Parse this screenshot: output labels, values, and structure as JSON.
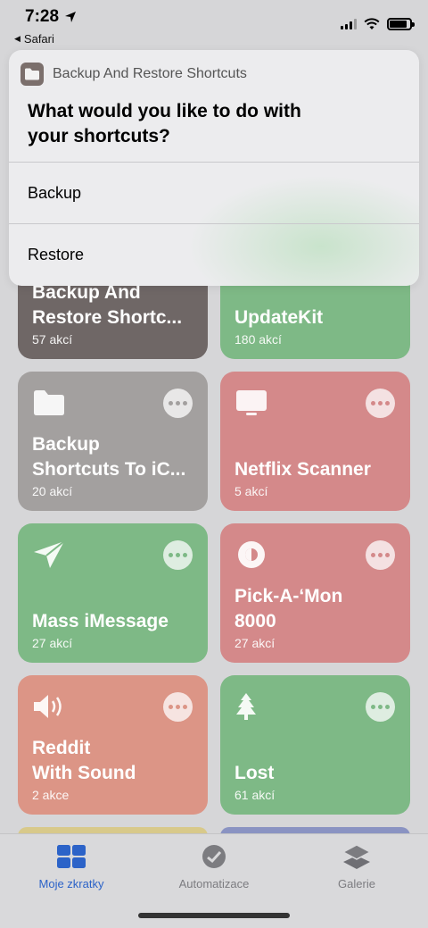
{
  "status_bar": {
    "time": "7:28",
    "back_app": "Safari"
  },
  "dialog": {
    "app_name": "Backup And Restore Shortcuts",
    "question": "What would you like to do with\nyour shortcuts?",
    "options": [
      {
        "label": "Backup"
      },
      {
        "label": "Restore"
      }
    ]
  },
  "shortcuts": [
    {
      "title": "Backup And\nRestore Shortc...",
      "subtitle": "57 akcí",
      "color": "#6f6766",
      "icon": "folder-icon"
    },
    {
      "title": "UpdateKit",
      "subtitle": "180 akcí",
      "color": "#7eb986",
      "icon": ""
    },
    {
      "title": "Backup\nShortcuts To iC...",
      "subtitle": "20 akcí",
      "color": "#a3a09f",
      "icon": "folder-icon"
    },
    {
      "title": "Netflix Scanner",
      "subtitle": "5 akcí",
      "color": "#d4898a",
      "icon": "tv-icon"
    },
    {
      "title": "Mass iMessage",
      "subtitle": "27 akcí",
      "color": "#7eb986",
      "icon": "paper-plane-icon"
    },
    {
      "title": "Pick-A-‘Mon\n8000",
      "subtitle": "27 akcí",
      "color": "#d4898a",
      "icon": "pokeball-icon"
    },
    {
      "title": "Reddit\nWith Sound",
      "subtitle": "2 akce",
      "color": "#dc9586",
      "icon": "speaker-icon"
    },
    {
      "title": "Lost",
      "subtitle": "61 akcí",
      "color": "#7eb986",
      "icon": "tree-icon"
    }
  ],
  "tabbar": {
    "tabs": [
      {
        "label": "Moje zkratky",
        "active": true,
        "icon": "grid-icon"
      },
      {
        "label": "Automatizace",
        "active": false,
        "icon": "clock-icon"
      },
      {
        "label": "Galerie",
        "active": false,
        "icon": "layers-icon"
      }
    ]
  },
  "colors": {
    "accent": "#2c63c8",
    "dim_background": "#d6d6d8"
  }
}
